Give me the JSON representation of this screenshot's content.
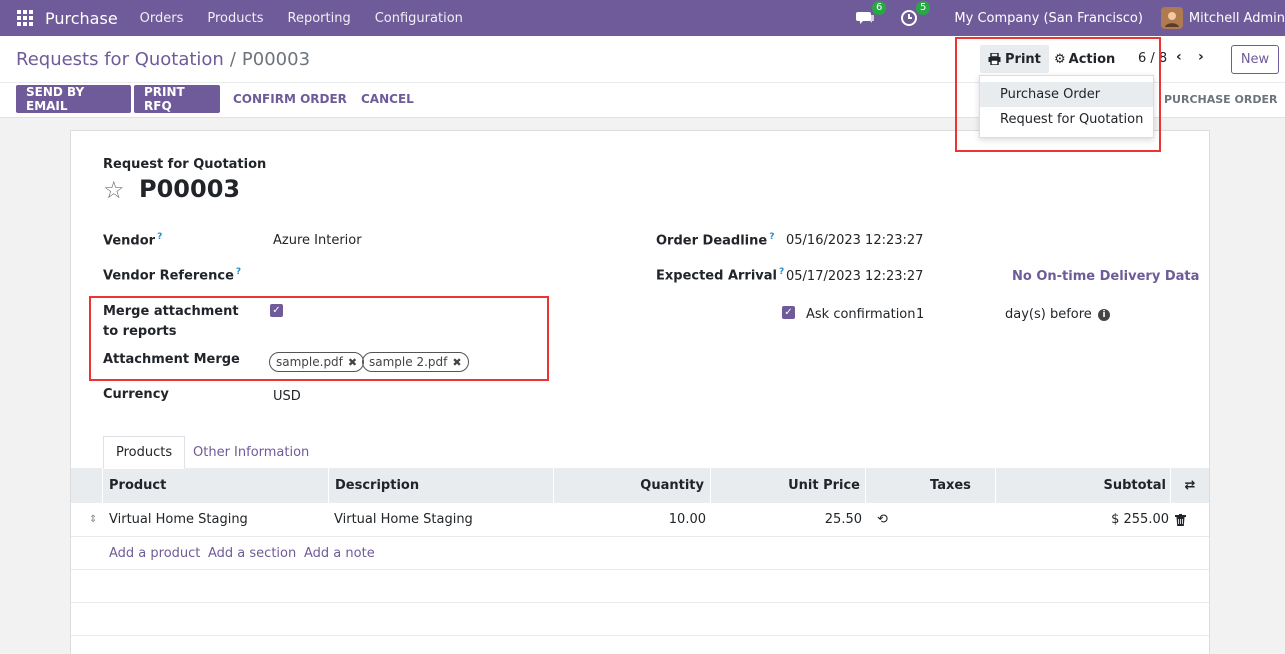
{
  "navbar": {
    "app_name": "Purchase",
    "menus": [
      "Orders",
      "Products",
      "Reporting",
      "Configuration"
    ],
    "messages_count": "6",
    "activities_count": "5",
    "company": "My Company (San Francisco)",
    "user": "Mitchell Admin",
    "bg_color": "#6f5b99"
  },
  "breadcrumb": {
    "parent": "Requests for Quotation",
    "separator": "/",
    "current": "P00003"
  },
  "toolbar": {
    "send_email": "SEND BY EMAIL",
    "print_rfq": "PRINT RFQ",
    "confirm_order": "CONFIRM ORDER",
    "cancel": "CANCEL",
    "print": "Print",
    "action": "Action",
    "pager": "6 / 8",
    "new": "New",
    "status_right": "PURCHASE ORDER"
  },
  "print_menu": {
    "items": [
      "Purchase Order",
      "Request for Quotation"
    ]
  },
  "form": {
    "doc_type": "Request for Quotation",
    "reference": "P00003",
    "vendor_label": "Vendor",
    "vendor_value": "Azure Interior",
    "vendor_ref_label": "Vendor Reference",
    "merge_label": "Merge attachment to reports",
    "merge_checked": true,
    "attach_label": "Attachment Merge",
    "attachments": [
      "sample.pdf",
      "sample 2.pdf"
    ],
    "currency_label": "Currency",
    "currency_value": "USD",
    "deadline_label": "Order Deadline",
    "deadline_value": "05/16/2023 12:23:27",
    "arrival_label": "Expected Arrival",
    "arrival_value": "05/17/2023 12:23:27",
    "no_delivery": "No On-time Delivery Data",
    "ask_label": "Ask confirmation",
    "ask_value": "1",
    "ask_suffix": "day(s) before",
    "help_mark": "?"
  },
  "tabs": [
    "Products",
    "Other Information"
  ],
  "table": {
    "headers": [
      "Product",
      "Description",
      "Quantity",
      "Unit Price",
      "Taxes",
      "Subtotal"
    ],
    "rows": [
      {
        "product": "Virtual Home Staging",
        "description": "Virtual Home Staging",
        "quantity": "10.00",
        "unit_price": "25.50",
        "taxes": "",
        "subtotal": "$ 255.00"
      }
    ],
    "add_product": "Add a product",
    "add_section": "Add a section",
    "add_note": "Add a note"
  },
  "icons": {
    "apps": "apps-grid-icon",
    "messages": "chat-icon",
    "activities": "clock-icon",
    "print": "printer-icon",
    "action": "gear-icon",
    "star": "star-icon",
    "delete": "trash-icon"
  }
}
